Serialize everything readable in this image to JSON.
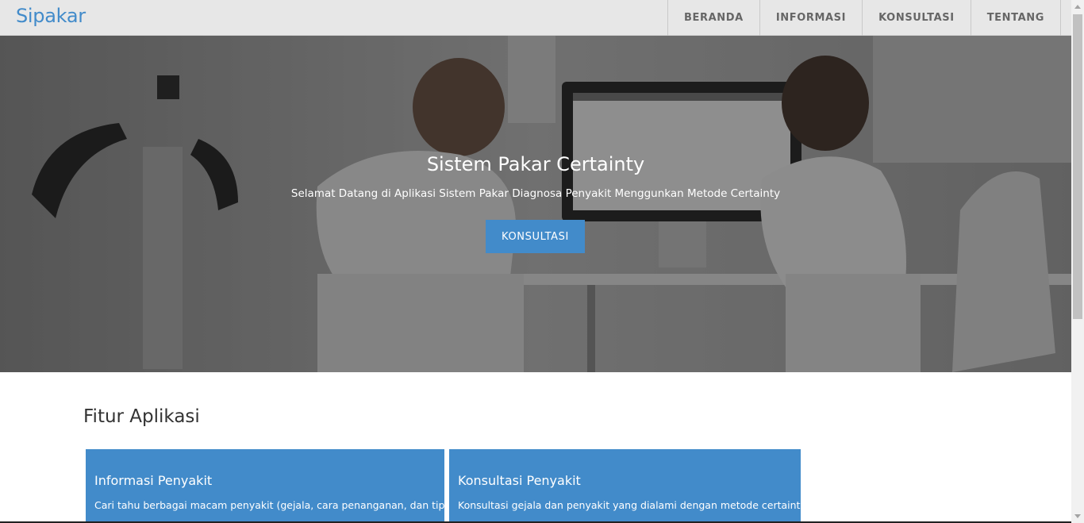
{
  "navbar": {
    "brand": "Sipakar",
    "items": [
      {
        "label": "BERANDA"
      },
      {
        "label": "INFORMASI"
      },
      {
        "label": "KONSULTASI"
      },
      {
        "label": "TENTANG"
      }
    ]
  },
  "hero": {
    "title": "Sistem Pakar Certainty",
    "subtitle": "Selamat Datang di Aplikasi Sistem Pakar Diagnosa Penyakit Menggunkan Metode Certainty",
    "button_label": "KONSULTASI"
  },
  "features": {
    "title": "Fitur Aplikasi",
    "cards": [
      {
        "title": "Informasi Penyakit",
        "description": "Cari tahu berbagai macam penyakit (gejala, cara penanganan, dan tips)"
      },
      {
        "title": "Konsultasi Penyakit",
        "description": "Konsultasi gejala dan penyakit yang dialami dengan metode certainty"
      }
    ]
  },
  "colors": {
    "accent": "#428bca",
    "navbar_bg": "#e7e7e7"
  }
}
